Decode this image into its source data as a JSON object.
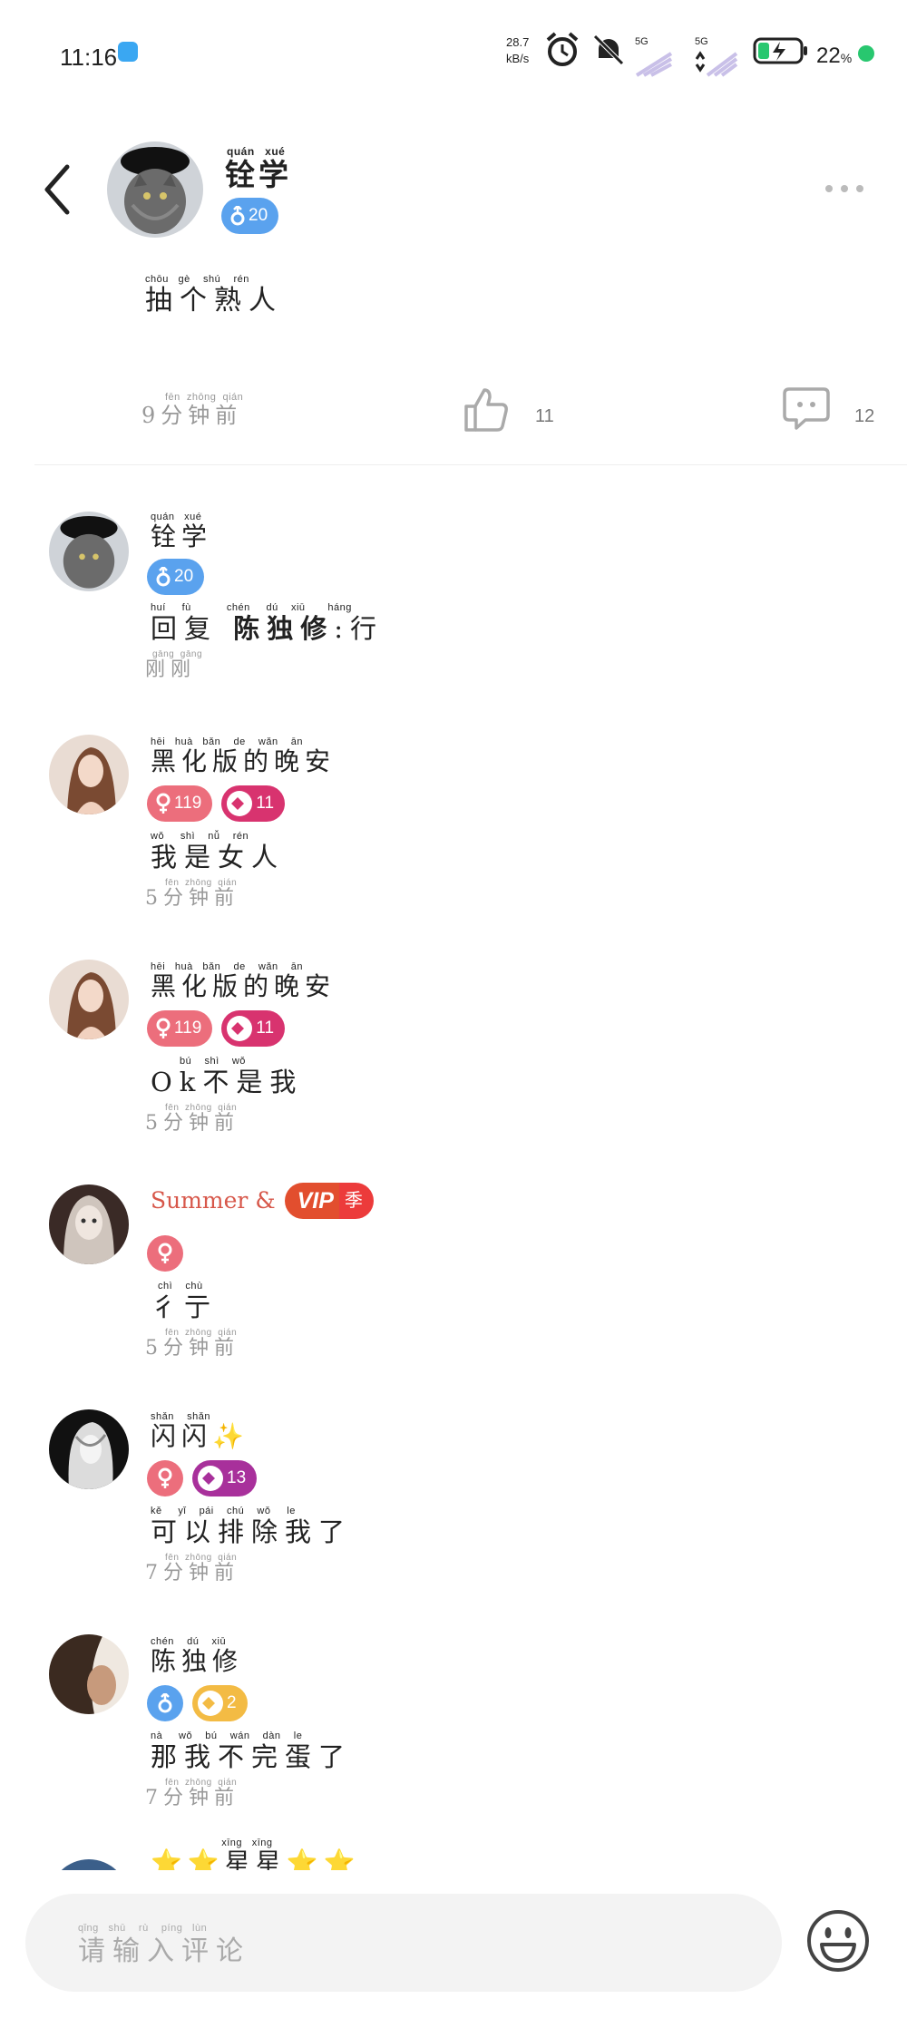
{
  "status_bar": {
    "time": "11:16",
    "net_speed_value": "28.7",
    "net_speed_unit": "kB/s",
    "signal_1": "5G",
    "signal_2": "5G",
    "battery": "22",
    "battery_unit": "%"
  },
  "post": {
    "author_pinyin": "quán   xué",
    "author": "铨学",
    "gender": "male",
    "age_badge": "20",
    "content_pinyin": "chōu   gè    shú    rén",
    "content": "抽个熟人",
    "time_pinyin": "fēn  zhōng  qián",
    "time": "9分钟前",
    "like_count": "11",
    "comment_count": "12"
  },
  "comments": [
    {
      "name_pinyin": "quán   xué",
      "name": "铨学",
      "badges": [
        {
          "type": "male",
          "text": "20"
        }
      ],
      "reply_pinyin": "huí     fù           chén     dú    xiū       háng",
      "reply_prefix": "回复 ",
      "reply_mention": "陈独修",
      "reply_text": ":行",
      "time_pinyin": "gāng  gāng",
      "time": "刚刚"
    },
    {
      "name_pinyin": "hēi   huà   bǎn    de    wǎn    ān",
      "name": "黑化版的晚安",
      "badges": [
        {
          "type": "female",
          "text": "119"
        },
        {
          "type": "level-pink",
          "text": "11"
        }
      ],
      "content_pinyin": "wǒ     shì    nǚ    rén",
      "content": "我是女人",
      "time_pinyin": "fēn  zhōng  qián",
      "time": "5分钟前"
    },
    {
      "name_pinyin": "hēi   huà   bǎn    de    wǎn    ān",
      "name": "黑化版的晚安",
      "badges": [
        {
          "type": "female",
          "text": "119"
        },
        {
          "type": "level-pink",
          "text": "11"
        }
      ],
      "content_pinyin": "         bú    shì    wǒ",
      "content": "Ok不是我",
      "time_pinyin": "fēn  zhōng  qián",
      "time": "5分钟前"
    },
    {
      "name": "Summer &",
      "vip_label": "VIP",
      "vip_season": "季",
      "badges": [
        {
          "type": "female-round",
          "text": ""
        }
      ],
      "content_pinyin": "chì    chù",
      "content": "彳亍",
      "time_pinyin": "fēn  zhōng  qián",
      "time": "5分钟前"
    },
    {
      "name_pinyin": "shǎn    shǎn",
      "name": "闪闪✨",
      "badges": [
        {
          "type": "female-round",
          "text": ""
        },
        {
          "type": "level-purple",
          "text": "13"
        }
      ],
      "content_pinyin": "kě     yǐ    pái    chú    wǒ     le",
      "content": "可以排除我了",
      "time_pinyin": "fēn  zhōng  qián",
      "time": "7分钟前"
    },
    {
      "name_pinyin": "chén    dú    xiū",
      "name": "陈独修",
      "badges": [
        {
          "type": "male-round",
          "text": ""
        },
        {
          "type": "level-orange",
          "text": "2"
        }
      ],
      "content_pinyin": "nà     wǒ    bú    wán    dàn    le",
      "content": "那我不完蛋了",
      "time_pinyin": "fēn  zhōng  qián",
      "time": "7分钟前"
    },
    {
      "name_pinyin": "                      xīng   xīng",
      "name": "⭐⭐星星⭐⭐"
    }
  ],
  "input": {
    "placeholder_pinyin": "qǐng   shū    rù    píng   lùn",
    "placeholder": "请输入评论"
  },
  "icons": {
    "back": "chevron-left-icon",
    "more": "more-dots-icon",
    "like": "thumbs-up-icon",
    "comment": "comment-bubble-icon",
    "emoji": "smiley-icon"
  },
  "colors": {
    "male_badge": "#5aa2ee",
    "female_badge": "#ec6e7c",
    "level_pink": "#d8336f",
    "level_purple": "#a8309b",
    "level_orange": "#f3bb44",
    "vip": "#e24e2e",
    "summer_name": "#d7574a"
  }
}
